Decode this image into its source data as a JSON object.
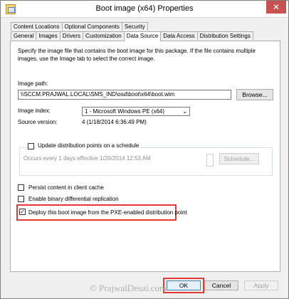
{
  "window": {
    "title": "Boot image (x64) Properties",
    "close_glyph": "✕"
  },
  "tabs_top": [
    "Content Locations",
    "Optional Components",
    "Security"
  ],
  "tabs_bottom": [
    "General",
    "Images",
    "Drivers",
    "Customization",
    "Data Source",
    "Data Access",
    "Distribution Settings"
  ],
  "active_tab": "Data Source",
  "panel": {
    "description": "Specify the image file that contains the boot image for this package. If the file contains multiple images, use the Image tab to select the correct image.",
    "image_path_label": "Image path:",
    "image_path_value": "\\\\SCCM.PRAJWAL.LOCAL\\SMS_IND\\osd\\boot\\x64\\boot.wim",
    "browse_label": "Browse...",
    "image_index_label": "Image index:",
    "image_index_value": "1 - Microsoft Windows PE (x64)",
    "source_version_label": "Source version:",
    "source_version_value": "4 (1/18/2014 6:36:49 PM)",
    "schedule_checkbox_label": "Update distribution points on a schedule",
    "schedule_text": "Occurs every 1 days effective 1/20/2014 12:53 AM",
    "schedule_button": "Schedule...",
    "persist_label": "Persist content in client cache",
    "binary_label": "Enable binary differential replication",
    "pxe_label": "Deploy this boot image from the PXE-enabled distribution point",
    "pxe_checked": true
  },
  "buttons": {
    "ok": "OK",
    "cancel": "Cancel",
    "apply": "Apply"
  },
  "watermark": "© PrajwalDesai.com",
  "colors": {
    "highlight": "#e53935",
    "close": "#c75050"
  },
  "icons": {
    "title": "package-icon",
    "close": "close-icon",
    "dropdown": "chevron-down-icon"
  }
}
